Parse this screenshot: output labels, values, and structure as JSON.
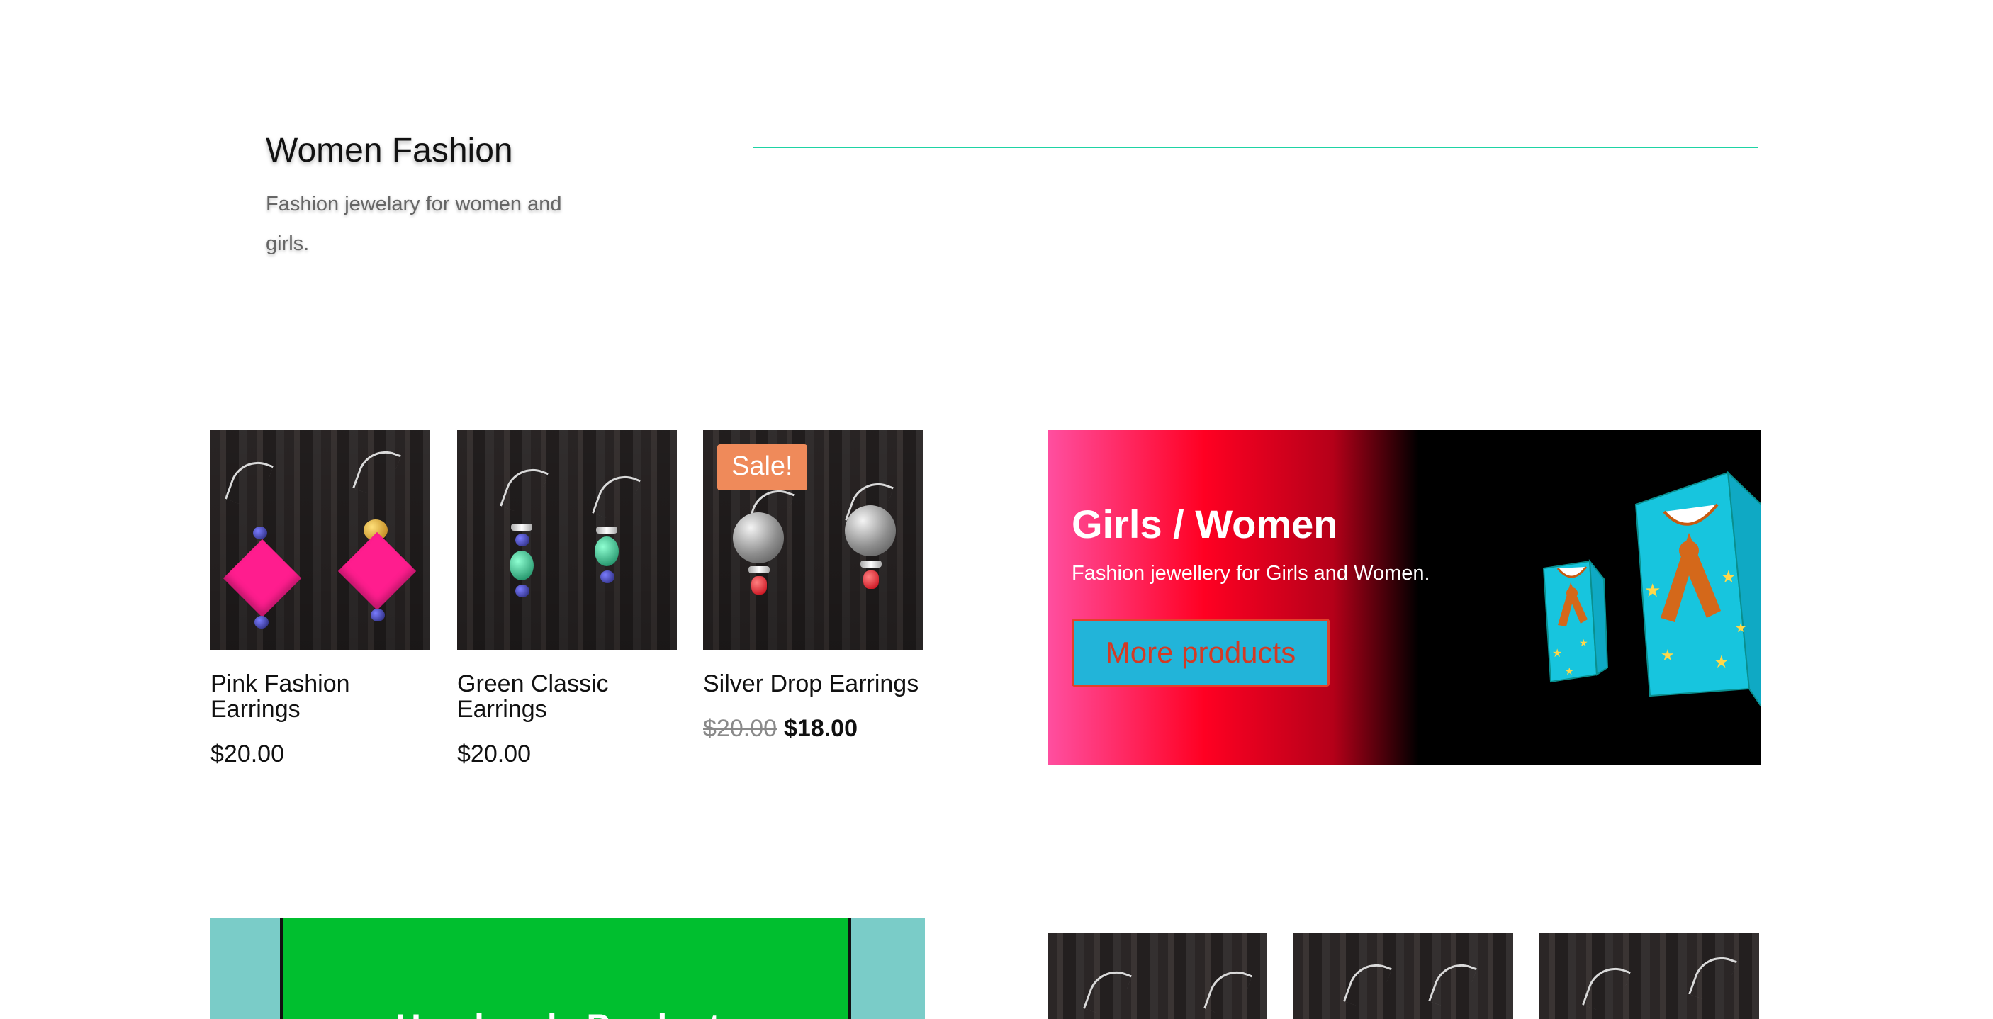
{
  "header": {
    "title": "Women Fashion",
    "subtitle": "Fashion jewelary for women and girls."
  },
  "products": [
    {
      "name": "Pink Fashion Earrings",
      "price": "$20.00"
    },
    {
      "name": "Green Classic Earrings",
      "price": "$20.00"
    },
    {
      "name": "Silver Drop Earrings",
      "sale_badge": "Sale!",
      "old_price": "$20.00",
      "price": "$18.00"
    }
  ],
  "promo": {
    "title": "Girls / Women",
    "text": "Fashion jewellery for Girls and Women.",
    "button_label": "More products"
  },
  "handmade": {
    "title": "Handmade Products"
  },
  "colors": {
    "divider": "#1ed3a4",
    "sale_badge": "#ef8a5a",
    "promo_button": "#22b4d9",
    "handmade_green": "#00bf2f"
  }
}
